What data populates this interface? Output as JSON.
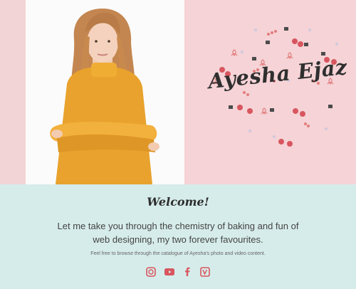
{
  "header": {
    "logo_text": "Ayesha Ejaz"
  },
  "welcome": {
    "title": "Welcome!",
    "body": "Let me take you through the chemistry of baking and fun of web designing, my two forever favourites.",
    "note": "Feel free to browse through the catalogue of Ayesha's photo and video content."
  },
  "socials": [
    {
      "icon": "instagram-icon"
    },
    {
      "icon": "youtube-icon"
    },
    {
      "icon": "facebook-icon"
    },
    {
      "icon": "vine-icon"
    }
  ],
  "colors": {
    "hero_pink": "#f3d4d6",
    "welcome_mint": "#d6ecea",
    "icon_accent": "#d8565f",
    "sweater": "#e8a22d"
  }
}
